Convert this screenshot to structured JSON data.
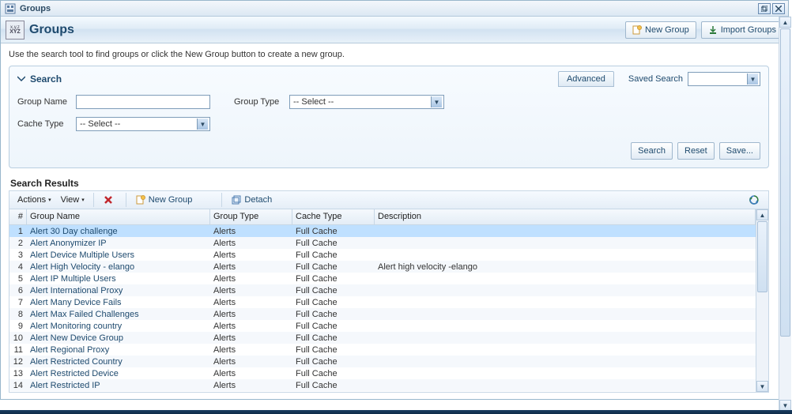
{
  "titlebar": {
    "title": "Groups"
  },
  "header": {
    "title": "Groups",
    "new_group": "New Group",
    "import_groups": "Import Groups"
  },
  "intro": "Use the search tool to find groups or click the New Group button to create a new group.",
  "search": {
    "title": "Search",
    "advanced": "Advanced",
    "saved_label": "Saved Search",
    "saved_value": "",
    "group_name_label": "Group Name",
    "group_name_value": "",
    "group_type_label": "Group Type",
    "group_type_value": "-- Select --",
    "cache_type_label": "Cache Type",
    "cache_type_value": "-- Select --",
    "search_btn": "Search",
    "reset_btn": "Reset",
    "save_btn": "Save..."
  },
  "results": {
    "title": "Search Results",
    "menu_actions": "Actions",
    "menu_view": "View",
    "new_group": "New Group",
    "detach": "Detach",
    "cols": {
      "num": "#",
      "name": "Group Name",
      "type": "Group Type",
      "cache": "Cache Type",
      "desc": "Description"
    },
    "rows": [
      {
        "n": "1",
        "name": "Alert 30 Day challenge",
        "type": "Alerts",
        "cache": "Full Cache",
        "desc": ""
      },
      {
        "n": "2",
        "name": "Alert Anonymizer IP",
        "type": "Alerts",
        "cache": "Full Cache",
        "desc": ""
      },
      {
        "n": "3",
        "name": "Alert Device Multiple Users",
        "type": "Alerts",
        "cache": "Full Cache",
        "desc": ""
      },
      {
        "n": "4",
        "name": "Alert High Velocity - elango",
        "type": "Alerts",
        "cache": "Full Cache",
        "desc": "Alert high velocity -elango"
      },
      {
        "n": "5",
        "name": "Alert IP Multiple Users",
        "type": "Alerts",
        "cache": "Full Cache",
        "desc": ""
      },
      {
        "n": "6",
        "name": "Alert International Proxy",
        "type": "Alerts",
        "cache": "Full Cache",
        "desc": ""
      },
      {
        "n": "7",
        "name": "Alert Many Device Fails",
        "type": "Alerts",
        "cache": "Full Cache",
        "desc": ""
      },
      {
        "n": "8",
        "name": "Alert Max Failed Challenges",
        "type": "Alerts",
        "cache": "Full Cache",
        "desc": ""
      },
      {
        "n": "9",
        "name": "Alert Monitoring country",
        "type": "Alerts",
        "cache": "Full Cache",
        "desc": ""
      },
      {
        "n": "10",
        "name": "Alert New Device Group",
        "type": "Alerts",
        "cache": "Full Cache",
        "desc": ""
      },
      {
        "n": "11",
        "name": "Alert Regional Proxy",
        "type": "Alerts",
        "cache": "Full Cache",
        "desc": ""
      },
      {
        "n": "12",
        "name": "Alert Restricted Country",
        "type": "Alerts",
        "cache": "Full Cache",
        "desc": ""
      },
      {
        "n": "13",
        "name": "Alert Restricted Device",
        "type": "Alerts",
        "cache": "Full Cache",
        "desc": ""
      },
      {
        "n": "14",
        "name": "Alert Restricted IP",
        "type": "Alerts",
        "cache": "Full Cache",
        "desc": ""
      }
    ]
  }
}
